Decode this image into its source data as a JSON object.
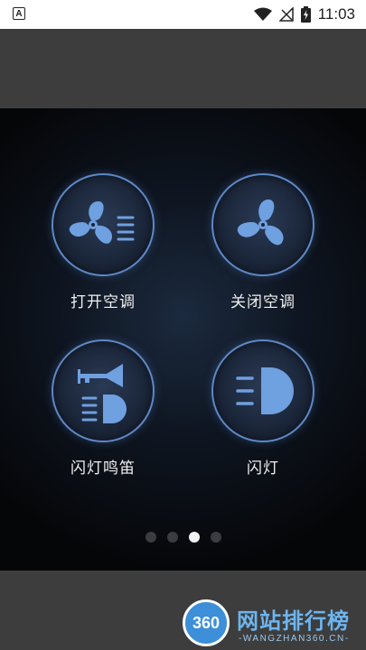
{
  "status_bar": {
    "left_icon": "a-icon",
    "time": "11:03"
  },
  "controls": [
    {
      "label": "打开空调",
      "icon": "fan-on-icon"
    },
    {
      "label": "关闭空调",
      "icon": "fan-icon"
    },
    {
      "label": "闪灯鸣笛",
      "icon": "horn-light-icon"
    },
    {
      "label": "闪灯",
      "icon": "headlight-icon"
    }
  ],
  "pager": {
    "count": 4,
    "active_index": 2
  },
  "watermark": {
    "logo_text": "360",
    "title": "网站排行榜",
    "subtitle": "-WANGZHAN360.CN-"
  },
  "colors": {
    "accent": "#6fa0e0",
    "ring": "#5e88c6",
    "watermark_blue": "#6db5f0"
  }
}
